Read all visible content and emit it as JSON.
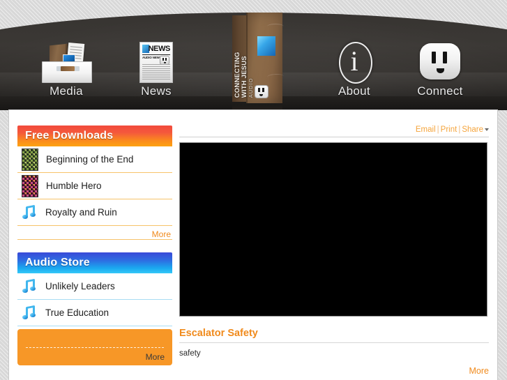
{
  "site": {
    "logo": {
      "line1": "CONNECTING",
      "line2": "WITH JESUS",
      "line3": "AUDIO",
      "name": "book-logo"
    },
    "nav": [
      {
        "id": "media",
        "label": "Media",
        "icon": "media-box-icon"
      },
      {
        "id": "news",
        "label": "News",
        "icon": "newspaper-icon"
      },
      {
        "id": "about",
        "label": "About",
        "icon": "info-circle-icon"
      },
      {
        "id": "connect",
        "label": "Connect",
        "icon": "power-outlet-icon"
      }
    ]
  },
  "news_icon": {
    "headline": "NEWS",
    "subhead": "AUDIO NEWS"
  },
  "sidebar": {
    "free_downloads": {
      "title": "Free Downloads",
      "accent": "#f4593c",
      "items": [
        {
          "label": "Beginning of the End",
          "icon": "album-art-thumbnail"
        },
        {
          "label": "Humble Hero",
          "icon": "album-art-thumbnail"
        },
        {
          "label": "Royalty and Ruin",
          "icon": "music-note-icon"
        }
      ],
      "more_label": "More"
    },
    "audio_store": {
      "title": "Audio Store",
      "accent": "#1aa8ef",
      "items": [
        {
          "label": "Unlikely Leaders",
          "icon": "music-note-icon"
        },
        {
          "label": "True Education",
          "icon": "music-note-icon"
        }
      ]
    },
    "promo": {
      "more_label": "More",
      "background": "#f79727"
    }
  },
  "main": {
    "utility": {
      "email_label": "Email",
      "print_label": "Print",
      "share_label": "Share",
      "separator": "|"
    },
    "player": {
      "name": "video-player",
      "state": "blank"
    },
    "article": {
      "title": "Escalator Safety",
      "body": "safety",
      "more_label": "More"
    }
  }
}
